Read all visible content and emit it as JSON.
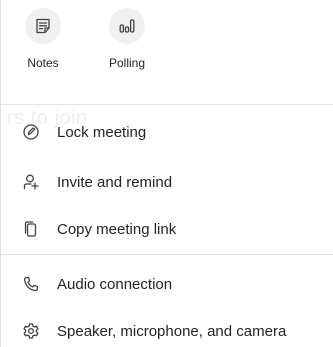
{
  "quick_actions": [
    {
      "label": "Notes",
      "icon": "notes-icon"
    },
    {
      "label": "Polling",
      "icon": "polling-icon"
    }
  ],
  "ghost_text": "rs to join",
  "menu": {
    "lock_meeting": "Lock meeting",
    "invite_and_remind": "Invite and remind",
    "copy_meeting_link": "Copy meeting link",
    "audio_connection": "Audio connection",
    "speaker_mic_camera": "Speaker, microphone, and camera"
  },
  "colors": {
    "text": "#242424",
    "icon": "#424242",
    "tile_background": "#f0f0f0",
    "divider": "#e1e1e1"
  }
}
